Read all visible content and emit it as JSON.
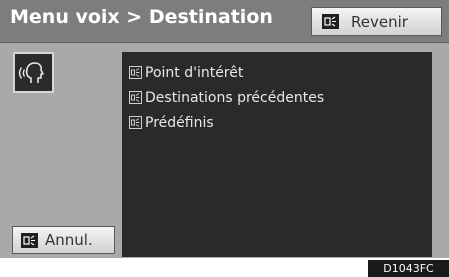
{
  "header": {
    "title": "Menu voix > Destination",
    "back_button": {
      "icon": "voice-key-icon",
      "label": "Revenir"
    }
  },
  "voice_command_button": {
    "icon": "speaking-head-icon"
  },
  "options": [
    {
      "icon": "voice-checkbox-icon",
      "label": "Point d'intérêt"
    },
    {
      "icon": "voice-checkbox-icon",
      "label": "Destinations précédentes"
    },
    {
      "icon": "voice-checkbox-icon",
      "label": "Prédéfinis"
    }
  ],
  "cancel_button": {
    "icon": "voice-key-icon",
    "label": "Annul."
  },
  "figure_code": "D1043FC",
  "colors": {
    "header_bg": "#7d7d7d",
    "screen_bg": "#a9a9a9",
    "panel_bg": "#2a2a2a",
    "button_bg": "#e6e6e6"
  }
}
